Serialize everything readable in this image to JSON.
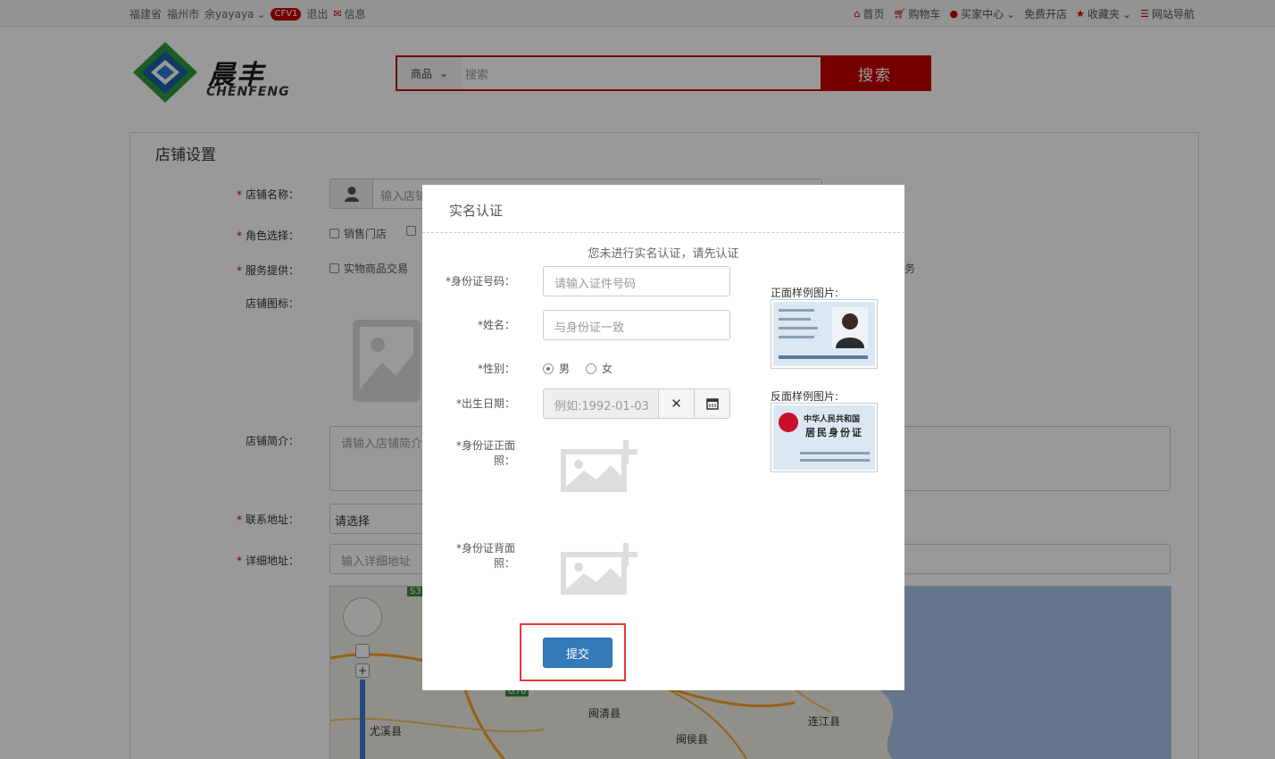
{
  "topbar": {
    "province": "福建省",
    "city": "福州市",
    "user": "余yayaya",
    "level_badge": "CFV1",
    "logout": "退出",
    "message": "信息",
    "home": "首页",
    "cart": "购物车",
    "buyer_center": "买家中心",
    "free_shop": "免费开店",
    "favorites": "收藏夹",
    "site_nav": "网站导航"
  },
  "logo": {
    "cn": "晨丰",
    "en": "CHENFENG"
  },
  "search": {
    "category": "商品",
    "placeholder": "搜索",
    "button": "搜索"
  },
  "shop_settings": {
    "title": "店铺设置",
    "name_label": "店铺名称：",
    "name_placeholder": "输入店铺",
    "role_label": "角色选择：",
    "role_option_1": "销售门店",
    "service_label": "服务提供：",
    "service_option_1": "实物商品交易",
    "service_option_tail": "务",
    "icon_label": "店铺图标：",
    "intro_label": "店铺简介：",
    "intro_placeholder": "请输入店铺简介",
    "address_label": "联系地址：",
    "address_value": "请选择",
    "detail_label": "详细地址：",
    "detail_placeholder": "输入详细地址"
  },
  "map": {
    "labels": [
      "S3",
      "G70",
      "闽清县",
      "尤溪县",
      "闽侯县",
      "连江县"
    ]
  },
  "modal": {
    "title": "实名认证",
    "notice": "您未进行实名认证，请先认证",
    "id_label": "*身份证号码：",
    "id_placeholder": "请输入证件号码",
    "name_label": "*姓名：",
    "name_placeholder": "与身份证一致",
    "gender_label": "*性别：",
    "gender_male": "男",
    "gender_female": "女",
    "birth_label": "*出生日期：",
    "birth_placeholder": "例如:1992-01-03",
    "front_label_1": "*身份证正面",
    "front_label_2": "照：",
    "back_label_1": "*身份证背面",
    "back_label_2": "照：",
    "front_sample_label": "正面样例图片:",
    "back_sample_label": "反面样例图片:",
    "back_sample_text_1": "中华人民共和国",
    "back_sample_text_2": "居民身份证",
    "submit": "提交"
  }
}
